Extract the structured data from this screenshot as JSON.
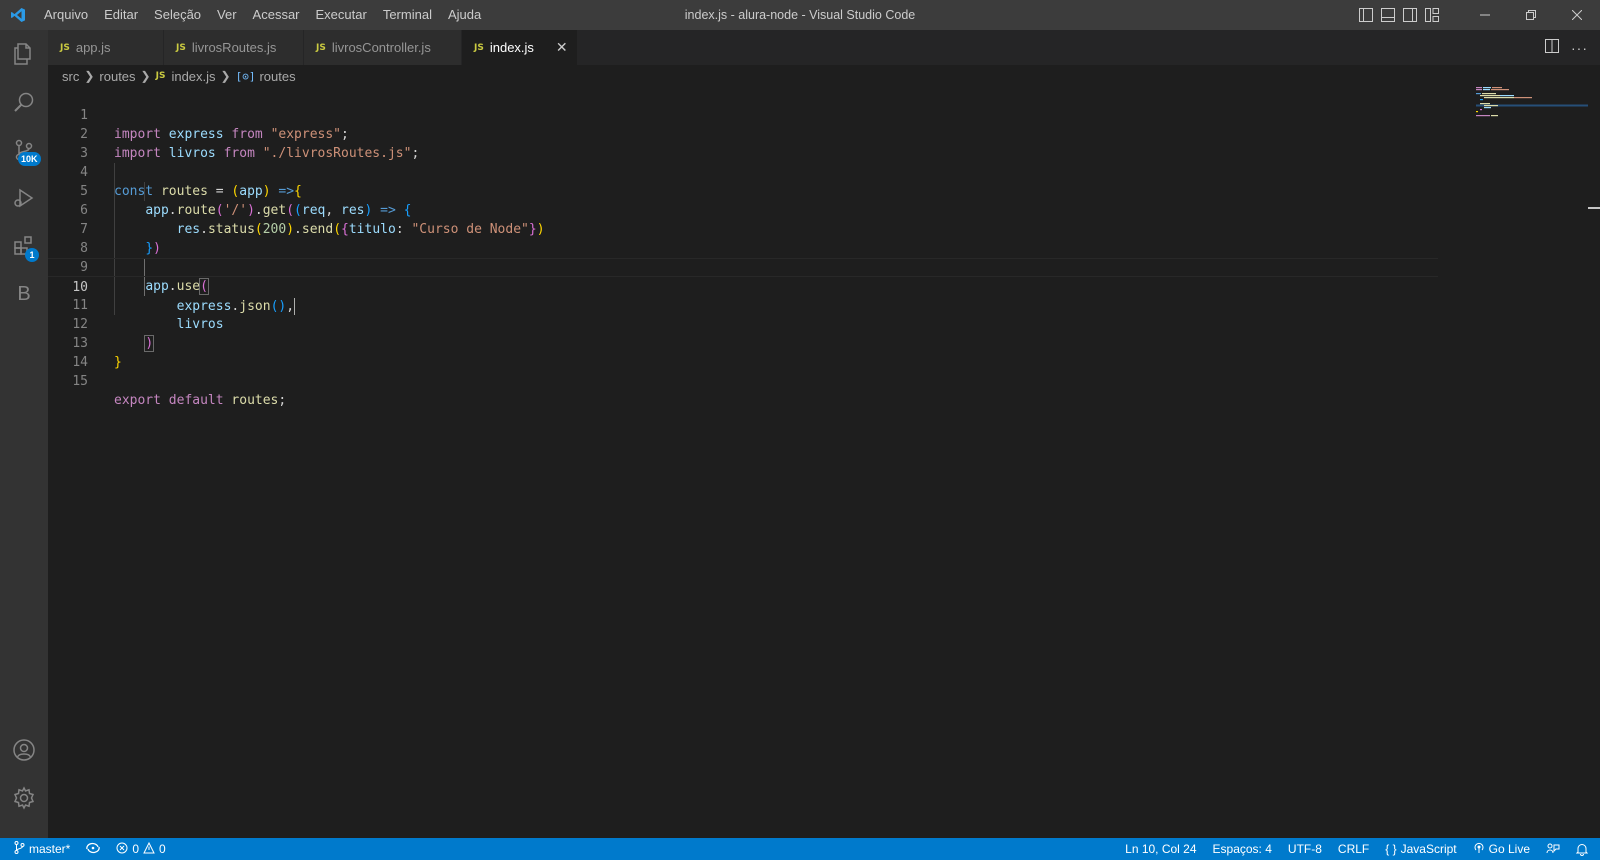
{
  "window": {
    "title": "index.js - alura-node - Visual Studio Code",
    "menu": [
      "Arquivo",
      "Editar",
      "Seleção",
      "Ver",
      "Acessar",
      "Executar",
      "Terminal",
      "Ajuda"
    ]
  },
  "activity_bar": {
    "source_control_badge": "10K",
    "extensions_badge": "1",
    "b_label": "B"
  },
  "tabs": [
    {
      "label": "app.js",
      "icon": "JS",
      "active": false
    },
    {
      "label": "livrosRoutes.js",
      "icon": "JS",
      "active": false
    },
    {
      "label": "livrosController.js",
      "icon": "JS",
      "active": false
    },
    {
      "label": "index.js",
      "icon": "JS",
      "active": true
    }
  ],
  "breadcrumb": {
    "items": [
      "src",
      "routes",
      "index.js",
      "routes"
    ],
    "file_icon": "JS",
    "symbol_icon": "[⊙]"
  },
  "editor": {
    "current_line": 10,
    "lines": [
      {
        "n": "1"
      },
      {
        "n": "2"
      },
      {
        "n": "3"
      },
      {
        "n": "4"
      },
      {
        "n": "5"
      },
      {
        "n": "6"
      },
      {
        "n": "7"
      },
      {
        "n": "8"
      },
      {
        "n": "9"
      },
      {
        "n": "10"
      },
      {
        "n": "11"
      },
      {
        "n": "12"
      },
      {
        "n": "13"
      },
      {
        "n": "14"
      },
      {
        "n": "15"
      }
    ],
    "tokens": {
      "l1": [
        "import",
        " ",
        "express",
        " ",
        "from",
        " ",
        "\"express\"",
        ";"
      ],
      "l2": [
        "import",
        " ",
        "livros",
        " ",
        "from",
        " ",
        "\"./livrosRoutes.js\"",
        ";"
      ],
      "l4": [
        "const",
        " ",
        "routes",
        " = ",
        "(",
        "app",
        ")",
        " ",
        "=>",
        "{"
      ],
      "l5": [
        "    ",
        "app",
        ".",
        "route",
        "(",
        "'/'",
        ")",
        ".",
        "get",
        "(",
        "(",
        "req",
        ", ",
        "res",
        ")",
        " ",
        "=>",
        " ",
        "{"
      ],
      "l6": [
        "        ",
        "res",
        ".",
        "status",
        "(",
        "200",
        ")",
        ".",
        "send",
        "(",
        "{",
        "titulo",
        ": ",
        "\"Curso de Node\"",
        "}",
        ")"
      ],
      "l7": [
        "    ",
        "}",
        ")"
      ],
      "l9": [
        "    ",
        "app",
        ".",
        "use",
        "("
      ],
      "l10": [
        "        ",
        "express",
        ".",
        "json",
        "()",
        ","
      ],
      "l11": [
        "        ",
        "livros"
      ],
      "l12": [
        "    ",
        ")"
      ],
      "l13": [
        "}"
      ],
      "l15": [
        "export",
        " ",
        "default",
        " ",
        "routes",
        ";"
      ]
    }
  },
  "status_bar": {
    "branch": "master*",
    "errors": "0",
    "warnings": "0",
    "position": "Ln 10, Col 24",
    "spaces": "Espaços: 4",
    "encoding": "UTF-8",
    "eol": "CRLF",
    "language": "JavaScript",
    "go_live": "Go Live",
    "language_icon": "{ }"
  },
  "colors": {
    "titlebar": "#3c3c3c",
    "activitybar": "#333333",
    "editor_bg": "#1e1e1e",
    "statusbar": "#007acc",
    "js_icon": "#cbcb41"
  }
}
